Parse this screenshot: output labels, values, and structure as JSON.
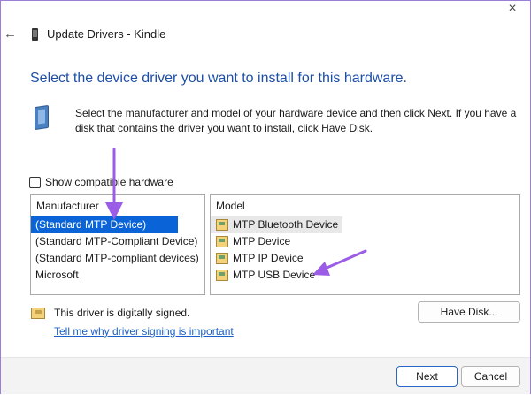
{
  "window": {
    "title": "Update Drivers - Kindle",
    "close_glyph": "×",
    "back_glyph": "←"
  },
  "heading": "Select the device driver you want to install for this hardware.",
  "instructions": "Select the manufacturer and model of your hardware device and then click Next. If you have a disk that contains the driver you want to install, click Have Disk.",
  "show_compatible": {
    "label": "Show compatible hardware",
    "checked": false
  },
  "manufacturer": {
    "header": "Manufacturer",
    "items": [
      "(Standard MTP Device)",
      "(Standard MTP-Compliant Device)",
      "(Standard MTP-compliant devices)",
      "Microsoft"
    ],
    "selected_index": 0
  },
  "model": {
    "header": "Model",
    "items": [
      "MTP Bluetooth Device",
      "MTP Device",
      "MTP IP Device",
      "MTP USB Device"
    ]
  },
  "signing": {
    "text": "This driver is digitally signed.",
    "link": "Tell me why driver signing is important"
  },
  "buttons": {
    "have_disk": "Have Disk...",
    "next": "Next",
    "cancel": "Cancel"
  },
  "annotation_color": "#9b5de5"
}
